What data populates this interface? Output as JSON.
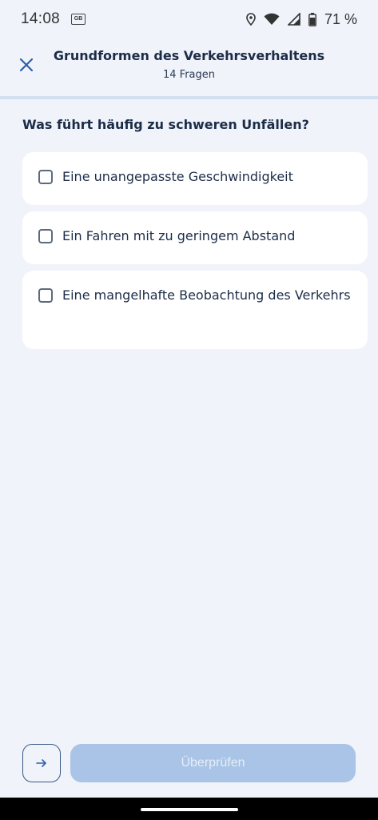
{
  "status_bar": {
    "time": "14:08",
    "notification_icon": "gb-news-icon",
    "battery_percent": "71 %",
    "icons": [
      "location-icon",
      "wifi-icon",
      "signal-icon",
      "battery-icon"
    ]
  },
  "header": {
    "title": "Grundformen des Verkehrsverhaltens",
    "subtitle": "14 Fragen",
    "close_icon": "close-icon"
  },
  "progress": {
    "fraction": 0.0
  },
  "question": {
    "text": "Was führt häufig zu schweren Unfällen?",
    "answers": [
      {
        "label": "Eine unangepasste Geschwindigkeit",
        "checked": false
      },
      {
        "label": "Ein Fahren mit zu geringem Abstand",
        "checked": false
      },
      {
        "label": "Eine mangelhafte Beobachtung des Verkehrs",
        "checked": false
      }
    ]
  },
  "footer": {
    "next_icon": "arrow-right-icon",
    "check_label": "Überprüfen"
  },
  "colors": {
    "background": "#f0f3fa",
    "accent": "#2f5fa6",
    "button_disabled": "#a9c4e6",
    "text": "#1c2d48"
  }
}
